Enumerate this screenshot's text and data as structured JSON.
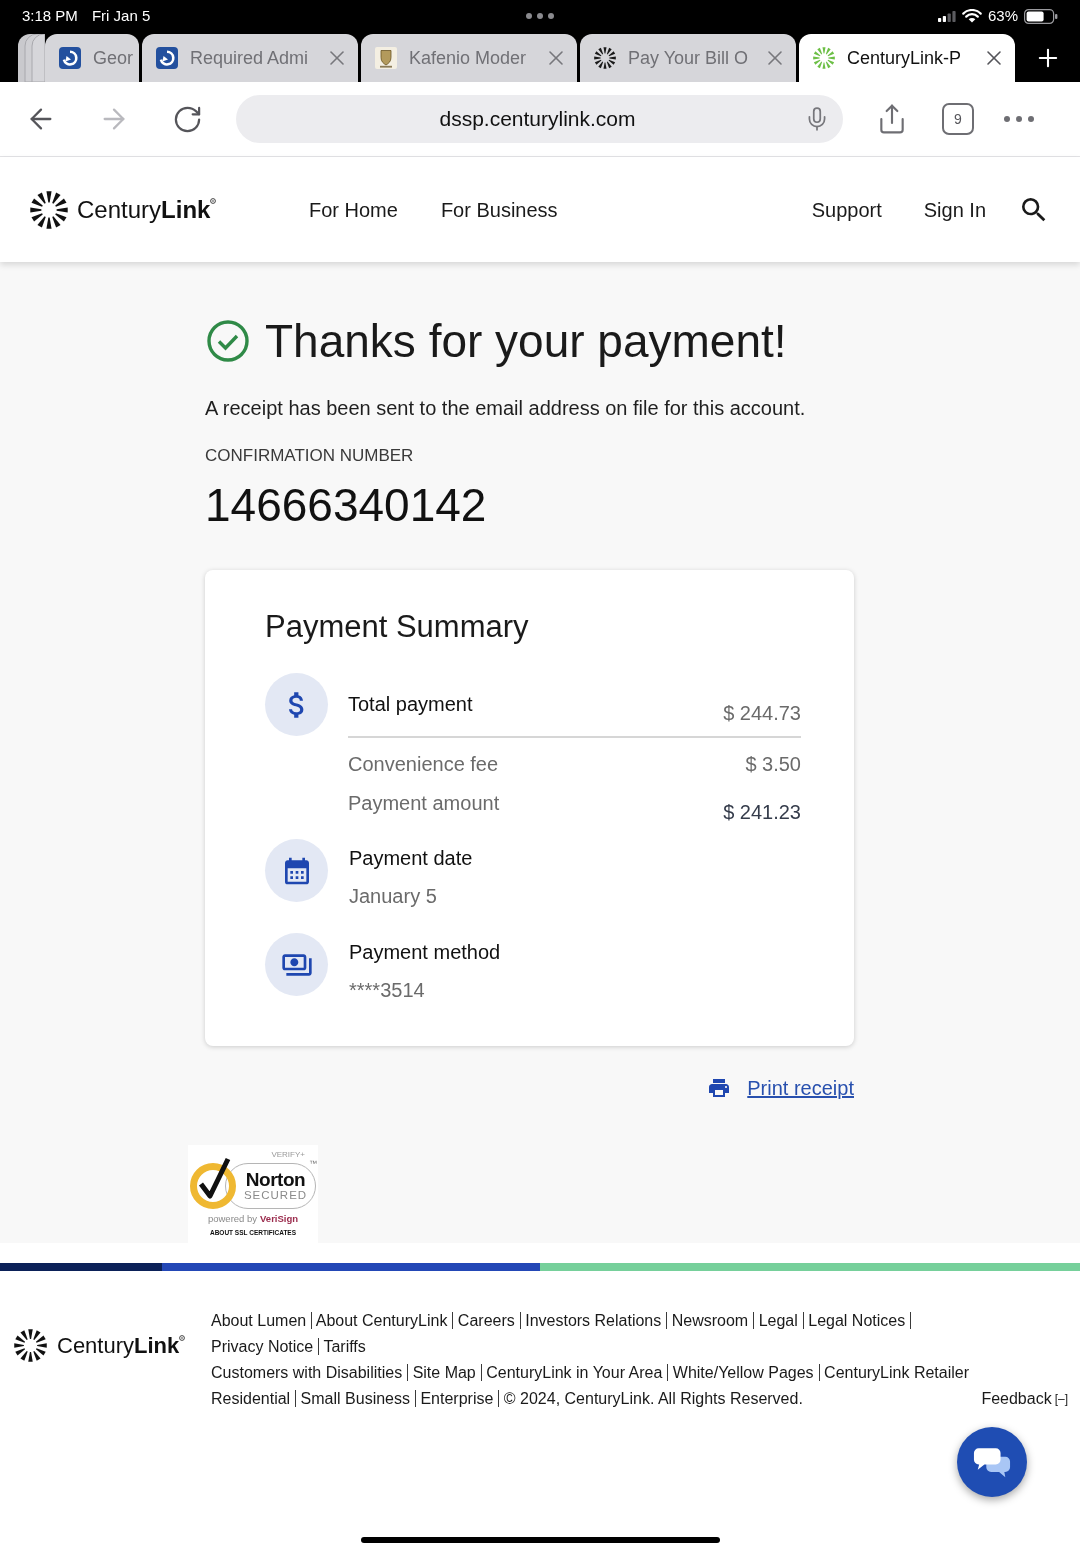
{
  "status_bar": {
    "time": "3:18 PM",
    "date": "Fri Jan 5",
    "battery": "63%"
  },
  "browser": {
    "tabs": [
      {
        "title": "Geor",
        "kind": "portal",
        "collapsed": true,
        "selected": false
      },
      {
        "title": "Required Admi",
        "kind": "portal",
        "collapsed": false,
        "selected": false
      },
      {
        "title": "Kafenio Moder",
        "kind": "crest",
        "collapsed": false,
        "selected": false
      },
      {
        "title": "Pay Your Bill O",
        "kind": "burst",
        "color": "#1a1a1a",
        "collapsed": false,
        "selected": false
      },
      {
        "title": "CenturyLink-P",
        "kind": "burst",
        "color": "#6cbf45",
        "collapsed": false,
        "selected": true
      }
    ],
    "url": "dssp.centurylink.com",
    "tab_count": "9"
  },
  "site_header": {
    "brand": "Century**Link**",
    "nav": [
      "For Home",
      "For Business"
    ],
    "utility": [
      "Support",
      "Sign In"
    ]
  },
  "confirmation": {
    "title": "Thanks for your payment!",
    "message": "A receipt has been sent to the email address on file for this account.",
    "number_label": "CONFIRMATION NUMBER",
    "number": "14666340142"
  },
  "payment_summary": {
    "title": "Payment Summary",
    "sections": [
      {
        "kind": "total",
        "label": "Total payment",
        "value": "$ 244.73",
        "details": [
          {
            "label": "Convenience fee",
            "value": "$ 3.50",
            "emphasis": false
          },
          {
            "label": "Payment amount",
            "value": "$ 241.23",
            "emphasis": true
          }
        ]
      },
      {
        "kind": "date",
        "label": "Payment date",
        "value": "January 5"
      },
      {
        "kind": "method",
        "label": "Payment method",
        "value": "****3514"
      }
    ]
  },
  "print_link": "Print receipt",
  "norton_seal": {
    "tagline": "VERIFY+",
    "brand": "Norton",
    "trademark": "™",
    "status": "SECURED",
    "powered_by": "powered by",
    "partner": "VeriSign",
    "link": "ABOUT SSL CERTIFICATES"
  },
  "footer": {
    "brand": "Century**Link**",
    "link_groups": [
      [
        "About Lumen",
        "About CenturyLink",
        "Careers",
        "Investors Relations",
        "Newsroom",
        "Legal",
        "Legal Notices",
        "Privacy Notice",
        "Tariffs"
      ],
      [
        "Customers with Disabilities",
        "Site Map",
        "CenturyLink in Your Area",
        "White/Yellow Pages",
        "CenturyLink Retailer"
      ],
      [
        "Residential",
        "Small Business",
        "Enterprise"
      ]
    ],
    "copyright": "© 2024, CenturyLink. All Rights Reserved.",
    "feedback": "Feedback",
    "feedback_toggle": "[–]"
  }
}
